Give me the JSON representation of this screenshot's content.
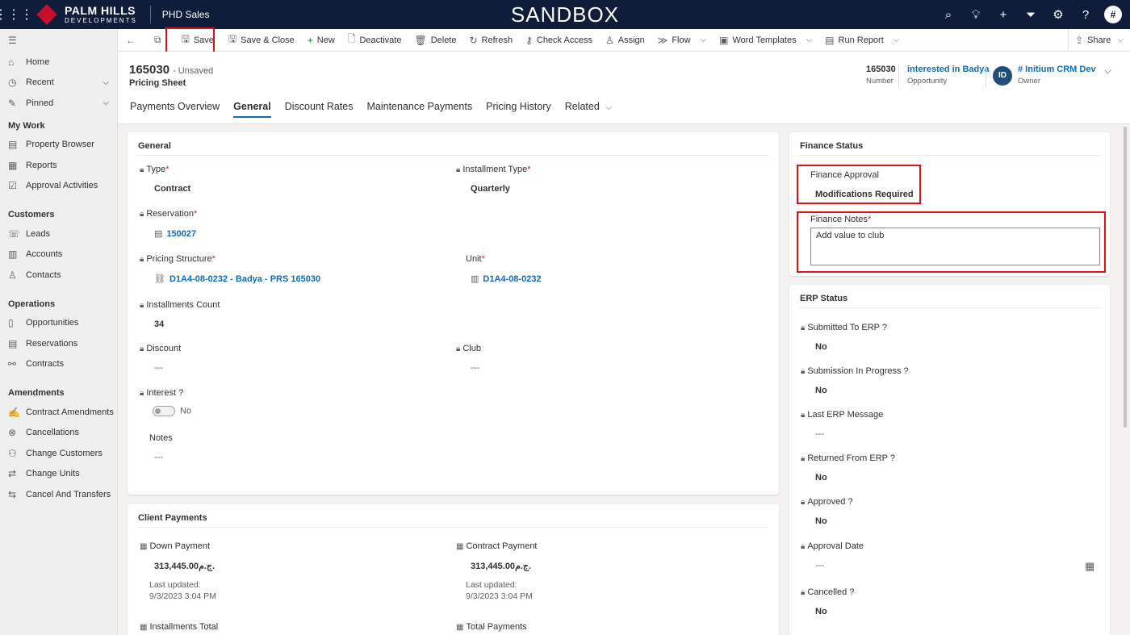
{
  "topbar": {
    "brand_line1": "PALM HILLS",
    "brand_line2": "DEVELOPMENTS",
    "app_name": "PHD Sales",
    "environment": "SANDBOX",
    "user_initial": "#"
  },
  "sidebar": {
    "top_items": [
      {
        "label": "Home"
      },
      {
        "label": "Recent"
      },
      {
        "label": "Pinned"
      }
    ],
    "groups": [
      {
        "title": "My Work",
        "items": [
          "Property Browser",
          "Reports",
          "Approval Activities"
        ]
      },
      {
        "title": "Customers",
        "items": [
          "Leads",
          "Accounts",
          "Contacts"
        ]
      },
      {
        "title": "Operations",
        "items": [
          "Opportunities",
          "Reservations",
          "Contracts"
        ]
      },
      {
        "title": "Amendments",
        "items": [
          "Contract Amendments",
          "Cancellations",
          "Change Customers",
          "Change Units",
          "Cancel And Transfers"
        ]
      }
    ]
  },
  "commands": {
    "save": "Save",
    "save_close": "Save & Close",
    "new": "New",
    "deactivate": "Deactivate",
    "delete": "Delete",
    "refresh": "Refresh",
    "check_access": "Check Access",
    "assign": "Assign",
    "flow": "Flow",
    "word_templates": "Word Templates",
    "run_report": "Run Report",
    "share": "Share"
  },
  "record": {
    "title": "165030",
    "status": "- Unsaved",
    "entity": "Pricing Sheet",
    "header_fields": {
      "number_value": "165030",
      "number_label": "Number",
      "opportunity_value": "interested in Badya",
      "opportunity_label": "Opportunity",
      "owner_initials": "ID",
      "owner_value": "# Initium CRM Dev",
      "owner_label": "Owner"
    },
    "tabs": [
      "Payments Overview",
      "General",
      "Discount Rates",
      "Maintenance Payments",
      "Pricing History",
      "Related"
    ]
  },
  "general": {
    "title": "General",
    "type_label": "Type",
    "type_value": "Contract",
    "installment_type_label": "Installment Type",
    "installment_type_value": "Quarterly",
    "reservation_label": "Reservation",
    "reservation_value": "150027",
    "pricing_structure_label": "Pricing Structure",
    "pricing_structure_value": "D1A4-08-0232 - Badya - PRS 165030",
    "unit_label": "Unit",
    "unit_value": "D1A4-08-0232",
    "installments_count_label": "Installments Count",
    "installments_count_value": "34",
    "discount_label": "Discount",
    "discount_value": "---",
    "club_label": "Club",
    "club_value": "---",
    "interest_label": "Interest ?",
    "interest_value": "No",
    "notes_label": "Notes",
    "notes_value": "---"
  },
  "client_payments": {
    "title": "Client Payments",
    "down_payment_label": "Down Payment",
    "down_payment_value": "313,445.00ج.م.",
    "down_payment_updated_label": "Last updated:",
    "down_payment_updated": "9/3/2023 3:04 PM",
    "contract_payment_label": "Contract Payment",
    "contract_payment_value": "313,445.00ج.م.",
    "contract_payment_updated_label": "Last updated:",
    "contract_payment_updated": "9/3/2023 3:04 PM",
    "installments_total_label": "Installments Total",
    "total_payments_label": "Total Payments"
  },
  "finance_status": {
    "title": "Finance Status",
    "approval_label": "Finance Approval",
    "approval_value": "Modifications Required",
    "notes_label": "Finance Notes",
    "notes_value": "Add value to club"
  },
  "erp_status": {
    "title": "ERP Status",
    "fields": [
      {
        "label": "Submitted To ERP ?",
        "value": "No"
      },
      {
        "label": "Submission In Progress ?",
        "value": "No"
      },
      {
        "label": "Last ERP Message",
        "value": "---"
      },
      {
        "label": "Returned From ERP ?",
        "value": "No"
      },
      {
        "label": "Approved ?",
        "value": "No"
      },
      {
        "label": "Approval Date",
        "value": "---"
      },
      {
        "label": "Cancelled ?",
        "value": "No"
      }
    ]
  }
}
